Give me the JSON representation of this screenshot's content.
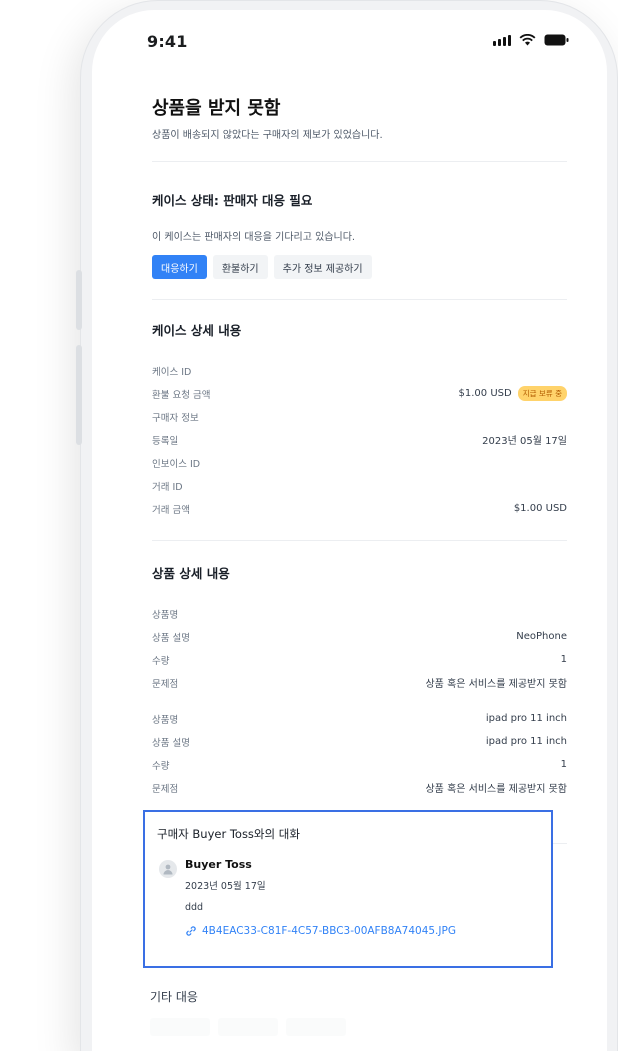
{
  "status": {
    "time": "9:41"
  },
  "header": {
    "title": "상품을 받지 못함",
    "subtitle": "상품이 배송되지 않았다는 구매자의 제보가 있었습니다."
  },
  "case_status": {
    "title": "케이스 상태: 판매자 대응 필요",
    "description": "이 케이스는 판매자의 대응을 기다리고 있습니다.",
    "buttons": [
      "대응하기",
      "환불하기",
      "추가 정보 제공하기"
    ]
  },
  "case_details": {
    "title": "케이스 상세 내용",
    "rows": [
      {
        "label": "케이스 ID",
        "value": ""
      },
      {
        "label": "환불 요청 금액",
        "value": "$1.00 USD",
        "badge": "지급 보류 중"
      },
      {
        "label": "구매자 정보",
        "value": ""
      },
      {
        "label": "등록일",
        "value": "2023년 05월 17일"
      },
      {
        "label": "인보이스 ID",
        "value": ""
      },
      {
        "label": "거래 ID",
        "value": ""
      },
      {
        "label": "거래 금액",
        "value": "$1.00 USD"
      }
    ]
  },
  "product_details": {
    "title": "상품 상세 내용",
    "groups": [
      [
        {
          "label": "상품명",
          "value": ""
        },
        {
          "label": "상품 설명",
          "value": "NeoPhone"
        },
        {
          "label": "수량",
          "value": "1"
        },
        {
          "label": "문제점",
          "value": "상품 혹은 서비스를 제공받지 못함"
        }
      ],
      [
        {
          "label": "상품명",
          "value": "ipad pro 11 inch"
        },
        {
          "label": "상품 설명",
          "value": "ipad pro 11 inch"
        },
        {
          "label": "수량",
          "value": "1"
        },
        {
          "label": "문제점",
          "value": "상품 혹은 서비스를 제공받지 못함"
        }
      ]
    ]
  },
  "conversation": {
    "title": "구매자 Buyer Toss와의 대화",
    "sender": "Buyer Toss",
    "date": "2023년 05월 17일",
    "message": "ddd",
    "attachment": "4B4EAC33-C81F-4C57-BBC3-00AFB8A74045.JPG"
  },
  "other": {
    "title": "기타 대응"
  },
  "colors": {
    "primary": "#3182f6",
    "highlight_border": "#3a6fe4",
    "badge_bg": "#ffd36b"
  }
}
